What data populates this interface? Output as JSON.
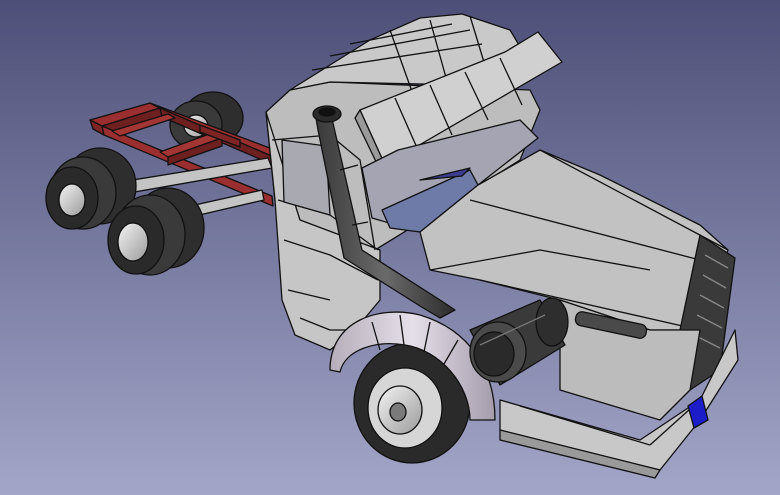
{
  "viewport": {
    "background_top": "#4d4f78",
    "background_bottom": "#a3a6c8"
  },
  "model": {
    "body_color": "#c8c8c8",
    "frame_color": "#8e2a2a",
    "tire_color": "#2e2e2e",
    "hub_color": "#e2e2e2",
    "fender_color": "#cfc8d4",
    "marker_color": "#1c1cc8",
    "edge_color": "#111111"
  }
}
